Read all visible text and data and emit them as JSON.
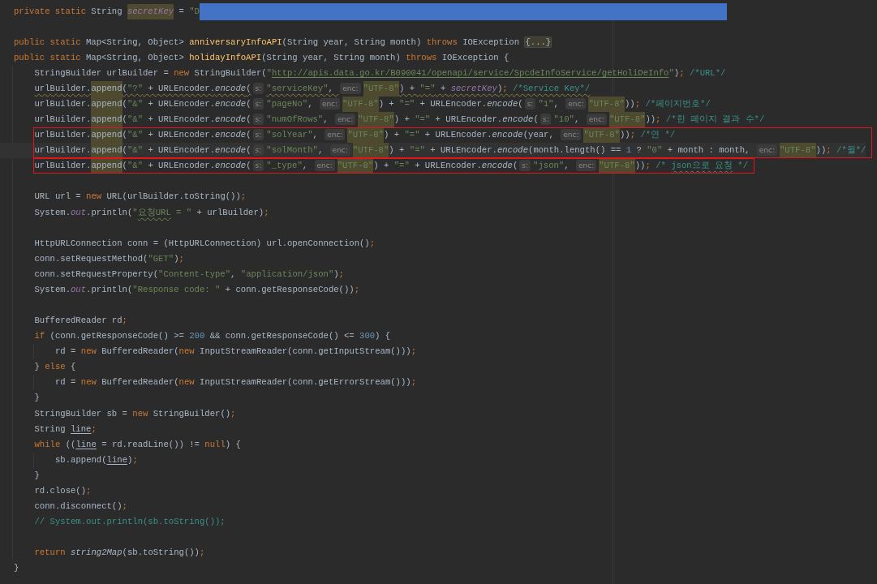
{
  "editor": {
    "lines": [
      {
        "kind": "code",
        "tokens": [
          {
            "kind": "keyword",
            "text": "private static "
          },
          {
            "kind": "plain",
            "text": "String "
          },
          {
            "kind": "field-match",
            "text": "secretKey"
          },
          {
            "kind": "plain",
            "text": " = "
          },
          {
            "kind": "string",
            "text": "\"D"
          },
          {
            "kind": "redacted"
          }
        ]
      },
      {
        "kind": "blank"
      },
      {
        "kind": "code",
        "tokens": [
          {
            "kind": "keyword",
            "text": "public static "
          },
          {
            "kind": "plain",
            "text": "Map<String, Object> "
          },
          {
            "kind": "method",
            "text": "anniversaryInfoAPI"
          },
          {
            "kind": "plain",
            "text": "(String year, String month) "
          },
          {
            "kind": "keyword",
            "text": "throws "
          },
          {
            "kind": "plain",
            "text": "IOException "
          },
          {
            "kind": "fold",
            "text": "{...}"
          }
        ]
      },
      {
        "kind": "code",
        "tokens": [
          {
            "kind": "keyword",
            "text": "public static "
          },
          {
            "kind": "plain",
            "text": "Map<String, Object> "
          },
          {
            "kind": "method",
            "text": "holidayInfoAPI"
          },
          {
            "kind": "plain",
            "text": "(String year, String month) "
          },
          {
            "kind": "keyword",
            "text": "throws "
          },
          {
            "kind": "plain",
            "text": "IOException {"
          }
        ],
        "children": [
          {
            "kind": "code",
            "tokens": [
              {
                "kind": "plain",
                "text": "StringBuilder urlBuilder = "
              },
              {
                "kind": "keyword",
                "text": "new "
              },
              {
                "kind": "plain",
                "text": "StringBuilder("
              },
              {
                "kind": "string",
                "text": "\""
              },
              {
                "kind": "link",
                "text": "http://apis.data.go.kr/B090041/openapi/service/SpcdeInfoService/getHoliDeInfo"
              },
              {
                "kind": "string",
                "text": "\""
              },
              {
                "kind": "plain",
                "text": ")"
              },
              {
                "kind": "punct",
                "text": "; "
              },
              {
                "kind": "comment",
                "text": "/*URL*/"
              }
            ]
          },
          {
            "kind": "code",
            "warning": true,
            "tokens": [
              {
                "kind": "plain",
                "text": "urlBuilder."
              },
              {
                "kind": "usage",
                "text": "append"
              },
              {
                "kind": "plain",
                "text": "("
              },
              {
                "kind": "string",
                "text": "\"?\""
              },
              {
                "kind": "plain",
                "text": " + URLEncoder."
              },
              {
                "kind": "static",
                "text": "encode"
              },
              {
                "kind": "plain",
                "text": "("
              },
              {
                "kind": "hint",
                "text": "s:"
              },
              {
                "kind": "string",
                "text": "\"serviceKey\""
              },
              {
                "kind": "plain",
                "text": ", "
              },
              {
                "kind": "hint",
                "text": "enc:"
              },
              {
                "kind": "match",
                "text": "\"UTF-8\""
              },
              {
                "kind": "plain",
                "text": ") + "
              },
              {
                "kind": "string",
                "text": "\"=\""
              },
              {
                "kind": "plain",
                "text": " + "
              },
              {
                "kind": "field",
                "text": "secretKey"
              },
              {
                "kind": "plain",
                "text": ")"
              },
              {
                "kind": "punct",
                "text": "; "
              },
              {
                "kind": "comment",
                "text": "/*Service Key*/"
              }
            ]
          },
          {
            "kind": "code",
            "tokens": [
              {
                "kind": "plain",
                "text": "urlBuilder."
              },
              {
                "kind": "usage",
                "text": "append"
              },
              {
                "kind": "plain",
                "text": "("
              },
              {
                "kind": "string",
                "text": "\"&\""
              },
              {
                "kind": "plain",
                "text": " + URLEncoder."
              },
              {
                "kind": "static",
                "text": "encode"
              },
              {
                "kind": "plain",
                "text": "("
              },
              {
                "kind": "hint",
                "text": "s:"
              },
              {
                "kind": "string",
                "text": "\"pageNo\""
              },
              {
                "kind": "plain",
                "text": ", "
              },
              {
                "kind": "hint",
                "text": "enc:"
              },
              {
                "kind": "match",
                "text": "\"UTF-8\""
              },
              {
                "kind": "plain",
                "text": ") + "
              },
              {
                "kind": "string",
                "text": "\"=\""
              },
              {
                "kind": "plain",
                "text": " + URLEncoder."
              },
              {
                "kind": "static",
                "text": "encode"
              },
              {
                "kind": "plain",
                "text": "("
              },
              {
                "kind": "hint",
                "text": "s:"
              },
              {
                "kind": "string",
                "text": "\"1\""
              },
              {
                "kind": "plain",
                "text": ", "
              },
              {
                "kind": "hint",
                "text": "enc:"
              },
              {
                "kind": "match",
                "text": "\"UTF-8\""
              },
              {
                "kind": "plain",
                "text": "))"
              },
              {
                "kind": "punct",
                "text": "; "
              },
              {
                "kind": "comment",
                "text": "/*페이지번호*/"
              }
            ]
          },
          {
            "kind": "code",
            "tokens": [
              {
                "kind": "plain",
                "text": "urlBuilder."
              },
              {
                "kind": "usage",
                "text": "append"
              },
              {
                "kind": "plain",
                "text": "("
              },
              {
                "kind": "string",
                "text": "\"&\""
              },
              {
                "kind": "plain",
                "text": " + URLEncoder."
              },
              {
                "kind": "static",
                "text": "encode"
              },
              {
                "kind": "plain",
                "text": "("
              },
              {
                "kind": "hint",
                "text": "s:"
              },
              {
                "kind": "string",
                "text": "\"numOfRows\""
              },
              {
                "kind": "plain",
                "text": ", "
              },
              {
                "kind": "hint",
                "text": "enc:"
              },
              {
                "kind": "match",
                "text": "\"UTF-8\""
              },
              {
                "kind": "plain",
                "text": ") + "
              },
              {
                "kind": "string",
                "text": "\"=\""
              },
              {
                "kind": "plain",
                "text": " + URLEncoder."
              },
              {
                "kind": "static",
                "text": "encode"
              },
              {
                "kind": "plain",
                "text": "("
              },
              {
                "kind": "hint",
                "text": "s:"
              },
              {
                "kind": "string",
                "text": "\"10\""
              },
              {
                "kind": "plain",
                "text": ", "
              },
              {
                "kind": "hint",
                "text": "enc:"
              },
              {
                "kind": "match",
                "text": "\"UTF-8\""
              },
              {
                "kind": "plain",
                "text": "))"
              },
              {
                "kind": "punct",
                "text": "; "
              },
              {
                "kind": "comment",
                "text": "/*한 페이지 결과 수*/"
              }
            ]
          },
          {
            "kind": "frame",
            "lines": [
              {
                "kind": "code",
                "tokens": [
                  {
                    "kind": "plain",
                    "text": "urlBuilder."
                  },
                  {
                    "kind": "usage",
                    "text": "append"
                  },
                  {
                    "kind": "plain",
                    "text": "("
                  },
                  {
                    "kind": "string",
                    "text": "\"&\""
                  },
                  {
                    "kind": "plain",
                    "text": " + URLEncoder."
                  },
                  {
                    "kind": "static",
                    "text": "encode"
                  },
                  {
                    "kind": "plain",
                    "text": "("
                  },
                  {
                    "kind": "hint",
                    "text": "s:"
                  },
                  {
                    "kind": "string",
                    "text": "\"solYear\""
                  },
                  {
                    "kind": "plain",
                    "text": ", "
                  },
                  {
                    "kind": "hint",
                    "text": "enc:"
                  },
                  {
                    "kind": "match",
                    "text": "\"UTF-8\""
                  },
                  {
                    "kind": "plain",
                    "text": ") + "
                  },
                  {
                    "kind": "string",
                    "text": "\"=\""
                  },
                  {
                    "kind": "plain",
                    "text": " + URLEncoder."
                  },
                  {
                    "kind": "static",
                    "text": "encode"
                  },
                  {
                    "kind": "plain",
                    "text": "(year, "
                  },
                  {
                    "kind": "hint",
                    "text": "enc:"
                  },
                  {
                    "kind": "match",
                    "text": "\"UTF-8\""
                  },
                  {
                    "kind": "plain",
                    "text": "))"
                  },
                  {
                    "kind": "punct",
                    "text": "; "
                  },
                  {
                    "kind": "comment",
                    "text": "/*연 */"
                  }
                ]
              },
              {
                "kind": "code",
                "current": true,
                "tokens": [
                  {
                    "kind": "plain",
                    "text": "urlBuilder."
                  },
                  {
                    "kind": "usage",
                    "text": "append"
                  },
                  {
                    "kind": "plain",
                    "text": "("
                  },
                  {
                    "kind": "string",
                    "text": "\"&\""
                  },
                  {
                    "kind": "plain",
                    "text": " + URLEncoder."
                  },
                  {
                    "kind": "static",
                    "text": "encode"
                  },
                  {
                    "kind": "plain",
                    "text": "("
                  },
                  {
                    "kind": "hint",
                    "text": "s:"
                  },
                  {
                    "kind": "string",
                    "text": "\"solMonth\""
                  },
                  {
                    "kind": "plain",
                    "text": ", "
                  },
                  {
                    "kind": "hint",
                    "text": "enc:"
                  },
                  {
                    "kind": "match",
                    "text": "\"UTF-8\""
                  },
                  {
                    "kind": "plain",
                    "text": ") + "
                  },
                  {
                    "kind": "string",
                    "text": "\"=\""
                  },
                  {
                    "kind": "plain",
                    "text": " + URLEncoder."
                  },
                  {
                    "kind": "static",
                    "text": "encode"
                  },
                  {
                    "kind": "plain",
                    "text": "(month.length() == "
                  },
                  {
                    "kind": "number",
                    "text": "1"
                  },
                  {
                    "kind": "plain",
                    "text": " ? "
                  },
                  {
                    "kind": "string",
                    "text": "\"0\""
                  },
                  {
                    "kind": "plain",
                    "text": " + month : month, "
                  },
                  {
                    "kind": "hint",
                    "text": "enc:"
                  },
                  {
                    "kind": "match",
                    "text": "\"UTF-8\""
                  },
                  {
                    "kind": "plain",
                    "text": "))"
                  },
                  {
                    "kind": "punct",
                    "text": "; "
                  },
                  {
                    "kind": "comment",
                    "text": "/*월*/"
                  }
                ]
              }
            ]
          },
          {
            "kind": "frame",
            "lines": [
              {
                "kind": "code",
                "tokens": [
                  {
                    "kind": "plain",
                    "text": "urlBuilder."
                  },
                  {
                    "kind": "usage",
                    "text": "append"
                  },
                  {
                    "kind": "plain",
                    "text": "("
                  },
                  {
                    "kind": "string",
                    "text": "\"&\""
                  },
                  {
                    "kind": "plain",
                    "text": " + URLEncoder."
                  },
                  {
                    "kind": "static",
                    "text": "encode"
                  },
                  {
                    "kind": "plain",
                    "text": "("
                  },
                  {
                    "kind": "hint",
                    "text": "s:"
                  },
                  {
                    "kind": "string",
                    "text": "\"_type\""
                  },
                  {
                    "kind": "plain",
                    "text": ", "
                  },
                  {
                    "kind": "hint",
                    "text": "enc:"
                  },
                  {
                    "kind": "match",
                    "text": "\"UTF-8\""
                  },
                  {
                    "kind": "plain",
                    "text": ") + "
                  },
                  {
                    "kind": "string",
                    "text": "\"=\""
                  },
                  {
                    "kind": "plain",
                    "text": " + URLEncoder."
                  },
                  {
                    "kind": "static",
                    "text": "encode"
                  },
                  {
                    "kind": "plain",
                    "text": "("
                  },
                  {
                    "kind": "hint",
                    "text": "s:"
                  },
                  {
                    "kind": "string",
                    "text": "\"json\""
                  },
                  {
                    "kind": "plain",
                    "text": ", "
                  },
                  {
                    "kind": "hint",
                    "text": "enc:"
                  },
                  {
                    "kind": "match",
                    "text": "\"UTF-8\""
                  },
                  {
                    "kind": "plain",
                    "text": "))"
                  },
                  {
                    "kind": "punct",
                    "text": "; "
                  },
                  {
                    "kind": "comment",
                    "text": "/* "
                  },
                  {
                    "kind": "comment-typo",
                    "text": "json으로 요청"
                  },
                  {
                    "kind": "comment",
                    "text": " */"
                  }
                ]
              }
            ]
          },
          {
            "kind": "blank"
          },
          {
            "kind": "code",
            "tokens": [
              {
                "kind": "plain",
                "text": "URL url = "
              },
              {
                "kind": "keyword",
                "text": "new "
              },
              {
                "kind": "plain",
                "text": "URL(urlBuilder.toString())"
              },
              {
                "kind": "punct",
                "text": ";"
              }
            ]
          },
          {
            "kind": "code",
            "tokens": [
              {
                "kind": "plain",
                "text": "System."
              },
              {
                "kind": "field",
                "text": "out"
              },
              {
                "kind": "plain",
                "text": ".println("
              },
              {
                "kind": "string",
                "text": "\""
              },
              {
                "kind": "string-typo",
                "text": "요청URL"
              },
              {
                "kind": "string",
                "text": " = \""
              },
              {
                "kind": "plain",
                "text": " + urlBuilder)"
              },
              {
                "kind": "punct",
                "text": ";"
              }
            ]
          },
          {
            "kind": "blank"
          },
          {
            "kind": "code",
            "tokens": [
              {
                "kind": "plain",
                "text": "HttpURLConnection conn = (HttpURLConnection) url.openConnection()"
              },
              {
                "kind": "punct",
                "text": ";"
              }
            ]
          },
          {
            "kind": "code",
            "tokens": [
              {
                "kind": "plain",
                "text": "conn.setRequestMethod("
              },
              {
                "kind": "string",
                "text": "\"GET\""
              },
              {
                "kind": "plain",
                "text": ")"
              },
              {
                "kind": "punct",
                "text": ";"
              }
            ]
          },
          {
            "kind": "code",
            "tokens": [
              {
                "kind": "plain",
                "text": "conn.setRequestProperty("
              },
              {
                "kind": "string",
                "text": "\"Content-type\""
              },
              {
                "kind": "plain",
                "text": ", "
              },
              {
                "kind": "string",
                "text": "\"application/json\""
              },
              {
                "kind": "plain",
                "text": ")"
              },
              {
                "kind": "punct",
                "text": ";"
              }
            ]
          },
          {
            "kind": "code",
            "tokens": [
              {
                "kind": "plain",
                "text": "System."
              },
              {
                "kind": "field",
                "text": "out"
              },
              {
                "kind": "plain",
                "text": ".println("
              },
              {
                "kind": "string",
                "text": "\"Response code: \""
              },
              {
                "kind": "plain",
                "text": " + conn.getResponseCode())"
              },
              {
                "kind": "punct",
                "text": ";"
              }
            ]
          },
          {
            "kind": "blank"
          },
          {
            "kind": "code",
            "tokens": [
              {
                "kind": "plain",
                "text": "BufferedReader rd"
              },
              {
                "kind": "punct",
                "text": ";"
              }
            ]
          },
          {
            "kind": "code",
            "tokens": [
              {
                "kind": "keyword",
                "text": "if "
              },
              {
                "kind": "plain",
                "text": "(conn.getResponseCode() >= "
              },
              {
                "kind": "number",
                "text": "200"
              },
              {
                "kind": "plain",
                "text": " && conn.getResponseCode() <= "
              },
              {
                "kind": "number",
                "text": "300"
              },
              {
                "kind": "plain",
                "text": ") {"
              }
            ],
            "children": [
              {
                "kind": "code",
                "tokens": [
                  {
                    "kind": "plain",
                    "text": "rd = "
                  },
                  {
                    "kind": "keyword",
                    "text": "new "
                  },
                  {
                    "kind": "plain",
                    "text": "BufferedReader("
                  },
                  {
                    "kind": "keyword",
                    "text": "new "
                  },
                  {
                    "kind": "plain",
                    "text": "InputStreamReader(conn.getInputStream()))"
                  },
                  {
                    "kind": "punct",
                    "text": ";"
                  }
                ]
              }
            ]
          },
          {
            "kind": "code",
            "tokens": [
              {
                "kind": "plain",
                "text": "} "
              },
              {
                "kind": "keyword",
                "text": "else "
              },
              {
                "kind": "plain",
                "text": "{"
              }
            ],
            "children": [
              {
                "kind": "code",
                "tokens": [
                  {
                    "kind": "plain",
                    "text": "rd = "
                  },
                  {
                    "kind": "keyword",
                    "text": "new "
                  },
                  {
                    "kind": "plain",
                    "text": "BufferedReader("
                  },
                  {
                    "kind": "keyword",
                    "text": "new "
                  },
                  {
                    "kind": "plain",
                    "text": "InputStreamReader(conn.getErrorStream()))"
                  },
                  {
                    "kind": "punct",
                    "text": ";"
                  }
                ]
              }
            ]
          },
          {
            "kind": "code",
            "tokens": [
              {
                "kind": "plain",
                "text": "}"
              }
            ]
          },
          {
            "kind": "code",
            "tokens": [
              {
                "kind": "plain",
                "text": "StringBuilder sb = "
              },
              {
                "kind": "keyword",
                "text": "new "
              },
              {
                "kind": "plain",
                "text": "StringBuilder()"
              },
              {
                "kind": "punct",
                "text": ";"
              }
            ]
          },
          {
            "kind": "code",
            "tokens": [
              {
                "kind": "plain",
                "text": "String "
              },
              {
                "kind": "reassigned",
                "text": "line"
              },
              {
                "kind": "punct",
                "text": ";"
              }
            ]
          },
          {
            "kind": "code",
            "tokens": [
              {
                "kind": "keyword",
                "text": "while "
              },
              {
                "kind": "plain",
                "text": "(("
              },
              {
                "kind": "reassigned",
                "text": "line"
              },
              {
                "kind": "plain",
                "text": " = rd.readLine()) != "
              },
              {
                "kind": "keyword",
                "text": "null"
              },
              {
                "kind": "plain",
                "text": ") {"
              }
            ],
            "children": [
              {
                "kind": "code",
                "tokens": [
                  {
                    "kind": "plain",
                    "text": "sb.append("
                  },
                  {
                    "kind": "reassigned",
                    "text": "line"
                  },
                  {
                    "kind": "plain",
                    "text": ")"
                  },
                  {
                    "kind": "punct",
                    "text": ";"
                  }
                ]
              }
            ]
          },
          {
            "kind": "code",
            "tokens": [
              {
                "kind": "plain",
                "text": "}"
              }
            ]
          },
          {
            "kind": "code",
            "tokens": [
              {
                "kind": "plain",
                "text": "rd.close()"
              },
              {
                "kind": "punct",
                "text": ";"
              }
            ]
          },
          {
            "kind": "code",
            "tokens": [
              {
                "kind": "plain",
                "text": "conn.disconnect()"
              },
              {
                "kind": "punct",
                "text": ";"
              }
            ]
          },
          {
            "kind": "code",
            "tokens": [
              {
                "kind": "comment",
                "text": "// System.out.println(sb.toString());"
              }
            ]
          },
          {
            "kind": "blank"
          },
          {
            "kind": "code",
            "tokens": [
              {
                "kind": "keyword",
                "text": "return "
              },
              {
                "kind": "static",
                "text": "string2Map"
              },
              {
                "kind": "plain",
                "text": "(sb.toString())"
              },
              {
                "kind": "punct",
                "text": ";"
              }
            ]
          }
        ]
      },
      {
        "kind": "code",
        "tokens": [
          {
            "kind": "plain",
            "text": "}"
          }
        ]
      }
    ]
  }
}
